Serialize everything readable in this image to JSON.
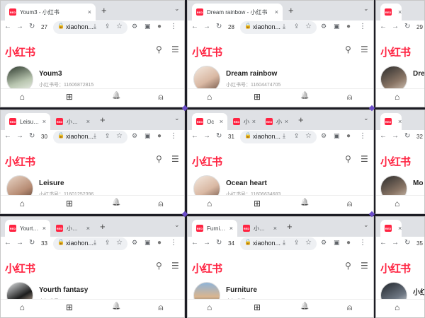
{
  "brand": {
    "logo_text": "小红书",
    "accent": "#ff2442"
  },
  "icons": {
    "back": "←",
    "forward": "→",
    "reload": "↻",
    "lock": "🔒",
    "install": "⤓",
    "share": "⇪",
    "star": "☆",
    "extensions": "⚙",
    "sidepanel": "▣",
    "profile": "●",
    "menu": "⋮",
    "close": "×",
    "newtab": "+",
    "tabmenu": "⌄",
    "search": "⚲",
    "hamburger": "☰",
    "home": "⌂",
    "post": "⊞",
    "bell": "🔔",
    "me": "⍝"
  },
  "windows": [
    {
      "tabs": [
        {
          "title": "Youm3 - 小红书",
          "active": true
        }
      ],
      "tab_no": "27",
      "url": "xiaohon...",
      "username": "Youm3",
      "userid": "小红书号：11606872815"
    },
    {
      "tabs": [
        {
          "title": "Dream rainbow - 小红书",
          "active": true
        }
      ],
      "tab_no": "28",
      "url": "xiaohon...",
      "username": "Dream rainbow",
      "userid": "小红书号：11604474705"
    },
    {
      "tabs": [
        {
          "title": "",
          "active": true
        }
      ],
      "tab_no": "29",
      "url": "",
      "username": "Dre",
      "userid": ""
    },
    {
      "tabs": [
        {
          "title": "Leisure - 小",
          "active": true
        },
        {
          "title": "小红书创作",
          "active": false
        }
      ],
      "tab_no": "30",
      "url": "xiaohon...",
      "username": "Leisure",
      "userid": "小红书号：11601252396"
    },
    {
      "tabs": [
        {
          "title": "Oc",
          "active": true
        },
        {
          "title": "小红",
          "active": false
        },
        {
          "title": "小红",
          "active": false
        }
      ],
      "tab_no": "31",
      "url": "xiaohon...",
      "username": "Ocean heart",
      "userid": "小红书号：11606634683"
    },
    {
      "tabs": [
        {
          "title": "",
          "active": true
        }
      ],
      "tab_no": "32",
      "url": "",
      "username": "Mo",
      "userid": ""
    },
    {
      "tabs": [
        {
          "title": "Yourth fan",
          "active": true
        },
        {
          "title": "小红书创作",
          "active": false
        }
      ],
      "tab_no": "33",
      "url": "xiaohon...",
      "username": "Yourth fantasy",
      "userid": "小红书号：11601296044"
    },
    {
      "tabs": [
        {
          "title": "Furniture",
          "active": true
        },
        {
          "title": "小红书创作",
          "active": false
        }
      ],
      "tab_no": "34",
      "url": "xiaohon...",
      "username": "Furniture",
      "userid": "小红书号：11602199479"
    },
    {
      "tabs": [
        {
          "title": "",
          "active": true
        }
      ],
      "tab_no": "35",
      "url": "",
      "username": "小红",
      "userid": ""
    }
  ]
}
